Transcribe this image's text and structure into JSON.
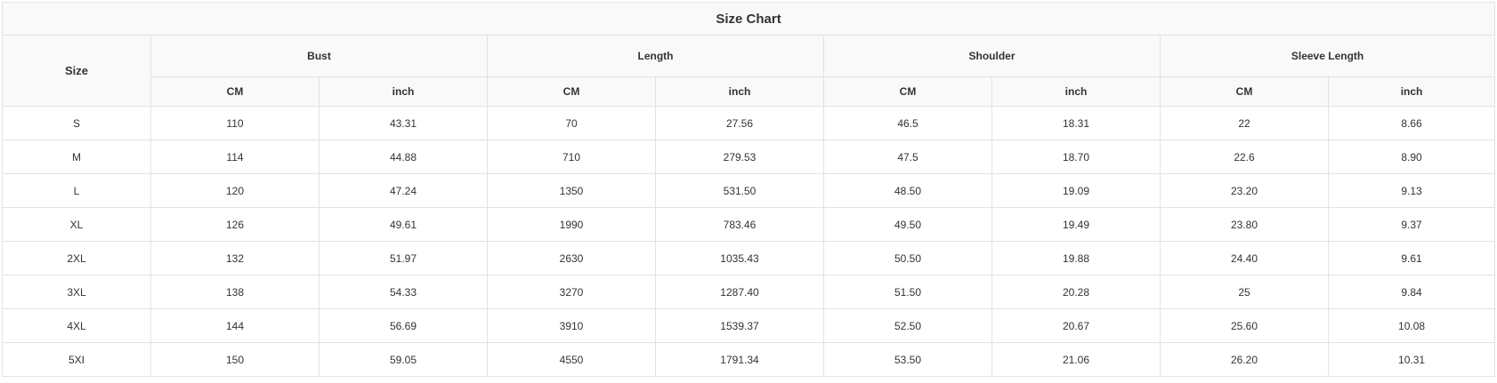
{
  "table": {
    "title": "Size Chart",
    "size_header": "Size",
    "groups": [
      {
        "label": "Bust",
        "units": [
          "CM",
          "inch"
        ]
      },
      {
        "label": "Length",
        "units": [
          "CM",
          "inch"
        ]
      },
      {
        "label": "Shoulder",
        "units": [
          "CM",
          "inch"
        ]
      },
      {
        "label": "Sleeve Length",
        "units": [
          "CM",
          "inch"
        ]
      }
    ],
    "rows": [
      [
        "S",
        "110",
        "43.31",
        "70",
        "27.56",
        "46.5",
        "18.31",
        "22",
        "8.66"
      ],
      [
        "M",
        "114",
        "44.88",
        "710",
        "279.53",
        "47.5",
        "18.70",
        "22.6",
        "8.90"
      ],
      [
        "L",
        "120",
        "47.24",
        "1350",
        "531.50",
        "48.50",
        "19.09",
        "23.20",
        "9.13"
      ],
      [
        "XL",
        "126",
        "49.61",
        "1990",
        "783.46",
        "49.50",
        "19.49",
        "23.80",
        "9.37"
      ],
      [
        "2XL",
        "132",
        "51.97",
        "2630",
        "1035.43",
        "50.50",
        "19.88",
        "24.40",
        "9.61"
      ],
      [
        "3XL",
        "138",
        "54.33",
        "3270",
        "1287.40",
        "51.50",
        "20.28",
        "25",
        "9.84"
      ],
      [
        "4XL",
        "144",
        "56.69",
        "3910",
        "1539.37",
        "52.50",
        "20.67",
        "25.60",
        "10.08"
      ],
      [
        "5XI",
        "150",
        "59.05",
        "4550",
        "1791.34",
        "53.50",
        "21.06",
        "26.20",
        "10.31"
      ]
    ]
  }
}
